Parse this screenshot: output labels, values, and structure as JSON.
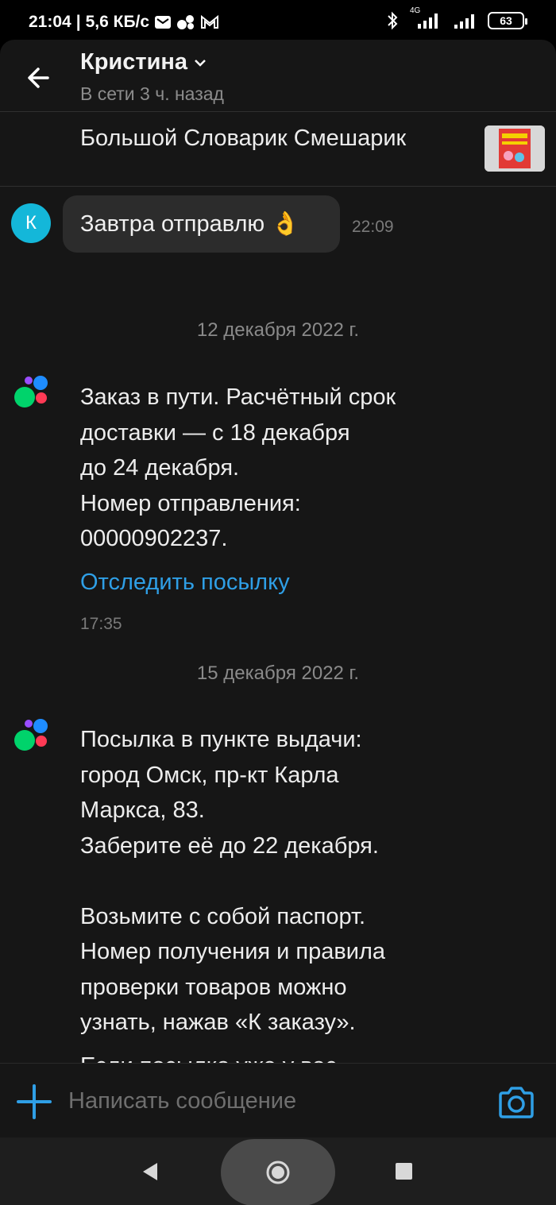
{
  "status_bar": {
    "time": "21:04",
    "network_speed": "5,6 КБ/с",
    "network_type": "4G",
    "battery": "63",
    "icons": [
      "mail-icon",
      "app-cluster-icon",
      "gmail-icon",
      "bluetooth-icon",
      "signal-icon",
      "battery-icon"
    ]
  },
  "header": {
    "contact_name": "Кристина",
    "contact_status": "В сети 3 ч. назад",
    "icons": [
      "back-arrow-icon",
      "chevron-down-icon"
    ]
  },
  "product": {
    "title": "Большой Словарик Смешарик",
    "thumbnail_colors": [
      "#e23a35",
      "#f4d000"
    ]
  },
  "messages": [
    {
      "type": "incoming",
      "avatar_letter": "К",
      "text": "Завтра отправлю 👌",
      "time": "22:09"
    },
    {
      "type": "date",
      "text": "12 декабря 2022 г."
    },
    {
      "type": "service",
      "text": "Заказ в пути. Расчётный срок\nдоставки — с 18 декабря\nдо 24 декабря.\nНомер отправления:\n00000902237.",
      "link": "Отследить посылку",
      "time": "17:35"
    },
    {
      "type": "date",
      "text": "15 декабря 2022 г."
    },
    {
      "type": "service",
      "text": "Посылка в пункте выдачи:\nгород Омск,  пр-кт Карла\nМаркса, 83.\nЗаберите её до 22 декабря.\n\nВозьмите с собой паспорт.\nНомер получения и правила\nпроверки товаров можно\nузнать, нажав «К заказу».",
      "text2": "Если посылка уже у вас,\nнажмите «Товар получен»."
    }
  ],
  "composer": {
    "placeholder": "Написать сообщение",
    "icons": [
      "plus-icon",
      "camera-icon"
    ]
  },
  "colors": {
    "background": "#161616",
    "bubble": "#2c2c2c",
    "accent": "#2f9fe6",
    "avatar": "#14b7d9",
    "logo_blue": "#1e8cff",
    "logo_purple": "#9a4dff",
    "logo_green": "#00d36b",
    "logo_red": "#ff3a55"
  }
}
